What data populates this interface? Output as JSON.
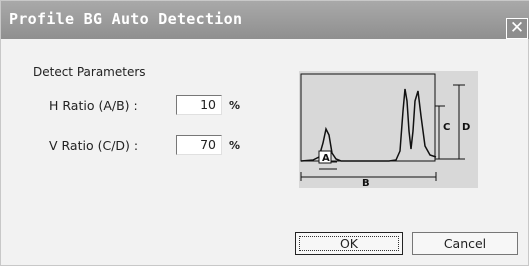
{
  "window": {
    "title": "Profile BG Auto Detection",
    "close_glyph": "✕"
  },
  "group": {
    "label": "Detect Parameters"
  },
  "h_ratio": {
    "label": "H Ratio (A/B) :",
    "value": "10",
    "unit": "%"
  },
  "v_ratio": {
    "label": "V Ratio (C/D) :",
    "value": "70",
    "unit": "%"
  },
  "diagram": {
    "label_a": "A",
    "label_b": "B",
    "label_c": "C",
    "label_d": "D"
  },
  "buttons": {
    "ok": "OK",
    "cancel": "Cancel"
  }
}
